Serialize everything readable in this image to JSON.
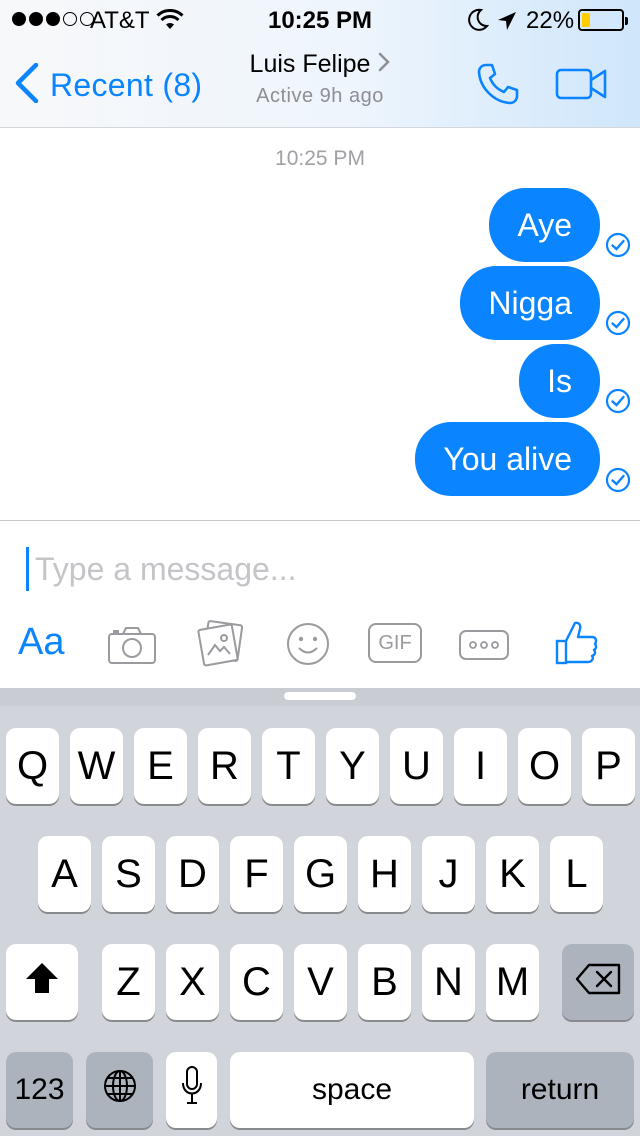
{
  "status_bar": {
    "carrier": "AT&T",
    "time": "10:25 PM",
    "battery_percent": "22%",
    "battery_level": 0.22,
    "signal_bars": 3,
    "signal_total": 5
  },
  "header": {
    "back_label": "Recent (8)",
    "contact_name": "Luis Felipe",
    "contact_status": "Active 9h ago",
    "accent_color": "#0a84ff"
  },
  "thread": {
    "timestamp": "10:25 PM",
    "messages": [
      {
        "text": "Aye",
        "status": "delivered"
      },
      {
        "text": "Nigga",
        "status": "delivered"
      },
      {
        "text": "Is",
        "status": "delivered"
      },
      {
        "text": "You alive",
        "status": "delivered"
      }
    ]
  },
  "composer": {
    "placeholder": "Type a message...",
    "text_format_label": "Aa",
    "gif_label": "GIF",
    "tools": [
      "camera-icon",
      "photo-library-icon",
      "emoji-icon",
      "gif-icon",
      "more-icon",
      "thumbs-up-icon"
    ]
  },
  "keyboard": {
    "row1": [
      "Q",
      "W",
      "E",
      "R",
      "T",
      "Y",
      "U",
      "I",
      "O",
      "P"
    ],
    "row2": [
      "A",
      "S",
      "D",
      "F",
      "G",
      "H",
      "J",
      "K",
      "L"
    ],
    "row3": [
      "Z",
      "X",
      "C",
      "V",
      "B",
      "N",
      "M"
    ],
    "numbers_label": "123",
    "space_label": "space",
    "return_label": "return"
  }
}
